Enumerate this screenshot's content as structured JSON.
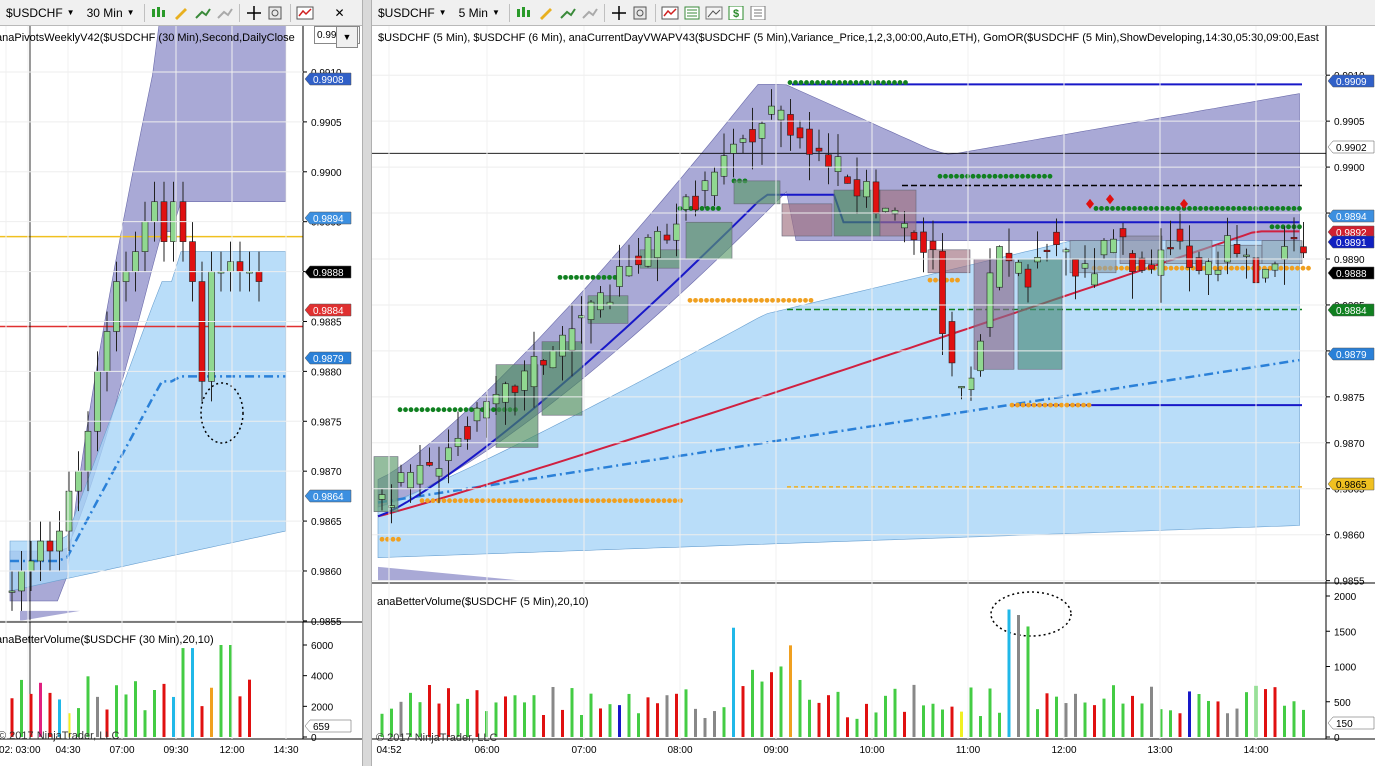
{
  "left_chart": {
    "symbol": "$USDCHF",
    "period": "30 Min",
    "top_box_value": "0.99",
    "indicator_title": "anaPivotsWeeklyV42($USDCHF (30 Min),Second,DailyClose",
    "volume_title": "anaBetterVolume($USDCHF (30 Min),20,10)",
    "copyright": "© 2017 NinjaTrader, LLC",
    "price_ticks": [
      "0.9910",
      "0.9905",
      "0.9900",
      "0.9895",
      "0.9890",
      "0.9885",
      "0.9880",
      "0.9875",
      "0.9870",
      "0.9865",
      "0.9860",
      "0.9855"
    ],
    "price_tags": [
      {
        "label": "0.9908",
        "color": "#3060c8"
      },
      {
        "label": "0.9894",
        "color": "#3c8fe0"
      },
      {
        "label": "0.9888",
        "color": "#000000"
      },
      {
        "label": "0.9884",
        "color": "#e03030"
      },
      {
        "label": "0.9879",
        "color": "#2a80d8"
      },
      {
        "label": "0.9864",
        "color": "#3c8fe0"
      }
    ],
    "volume_ticks": [
      "6000",
      "4000",
      "2000",
      "0"
    ],
    "volume_tag": "659",
    "time_labels": [
      "02:",
      "03:00",
      "04:30",
      "07:00",
      "09:30",
      "12:00",
      "14:30"
    ]
  },
  "right_chart": {
    "symbol": "$USDCHF",
    "period": "5 Min",
    "indicator_title": "$USDCHF (5 Min), $USDCHF (6 Min), anaCurrentDayVWAPV43($USDCHF (5 Min),Variance_Price,1,2,3,00:00,Auto,ETH), GomOR($USDCHF (5 Min),ShowDeveloping,14:30,05:30,09:00,East",
    "volume_title": "anaBetterVolume($USDCHF (5 Min),20,10)",
    "copyright": "© 2017 NinjaTrader, LLC",
    "price_ticks": [
      "0.9910",
      "0.9905",
      "0.9900",
      "0.9895",
      "0.9890",
      "0.9885",
      "0.9880",
      "0.9875",
      "0.9870",
      "0.9865",
      "0.9860",
      "0.9855"
    ],
    "price_tags": [
      {
        "label": "0.9909",
        "color": "#3060c8"
      },
      {
        "label": "0.9902",
        "color": "#ffffff"
      },
      {
        "label": "0.9894",
        "color": "#3c8fe0"
      },
      {
        "label": "0.9892",
        "color": "#d02030"
      },
      {
        "label": "0.9891",
        "color": "#1020c0"
      },
      {
        "label": "0.9888",
        "color": "#000000"
      },
      {
        "label": "0.9884",
        "color": "#108020"
      },
      {
        "label": "0.9879",
        "color": "#2a80d8"
      },
      {
        "label": "0.9865",
        "color": "#f0c020"
      }
    ],
    "volume_ticks": [
      "2000",
      "1500",
      "1000",
      "500",
      "0"
    ],
    "volume_tag": "150",
    "time_labels": [
      "04:52",
      "06:00",
      "07:00",
      "08:00",
      "09:00",
      "10:00",
      "11:00",
      "12:00",
      "13:00",
      "14:00"
    ]
  },
  "colors": {
    "up_candle": "#90d890",
    "down_candle": "#e01010",
    "band_purple": "#8c8cc8",
    "band_blue": "#a8d4f8",
    "vwap": "#1818c8",
    "ma": "#d02040"
  }
}
